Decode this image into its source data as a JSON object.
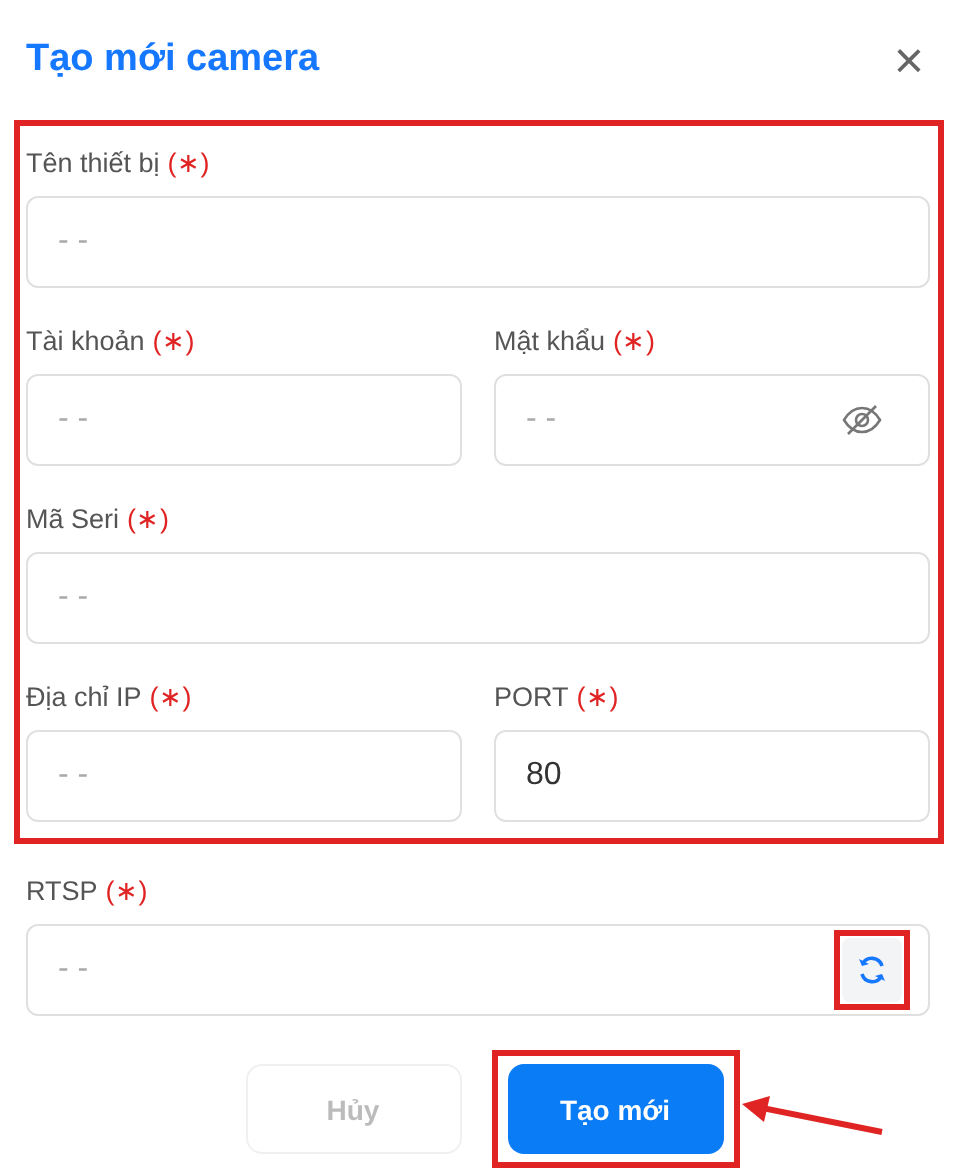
{
  "dialog": {
    "title": "Tạo mới camera",
    "close": "×"
  },
  "field_group": {
    "highlighted": true,
    "rows": [
      [
        {
          "kind": "text",
          "label": "Tên thiết bị",
          "required_mark": "(∗)",
          "placeholder": "- -"
        }
      ],
      [
        {
          "kind": "text",
          "label": "Tài khoản",
          "required_mark": "(∗)",
          "placeholder": "- -"
        },
        {
          "kind": "password",
          "label": "Mật khẩu",
          "required_mark": "(∗)",
          "placeholder": "- -"
        }
      ],
      [
        {
          "kind": "text",
          "label": "Mã Seri",
          "required_mark": "(∗)",
          "placeholder": "- -"
        }
      ],
      [
        {
          "kind": "text",
          "label": "Địa chỉ IP",
          "required_mark": "(∗)",
          "placeholder": "- -"
        },
        {
          "kind": "text",
          "label": "PORT",
          "required_mark": "(∗)",
          "value": "80"
        }
      ]
    ]
  },
  "rtsp": {
    "kind": "refresh",
    "label": "RTSP",
    "required_mark": "(∗)",
    "placeholder": "- -",
    "refresh_highlighted": true
  },
  "buttons": [
    {
      "kind": "cancel",
      "label": "Hủy",
      "disabled": true,
      "highlighted": false
    },
    {
      "kind": "primary",
      "label": "Tạo mới",
      "disabled": false,
      "highlighted": true
    }
  ]
}
